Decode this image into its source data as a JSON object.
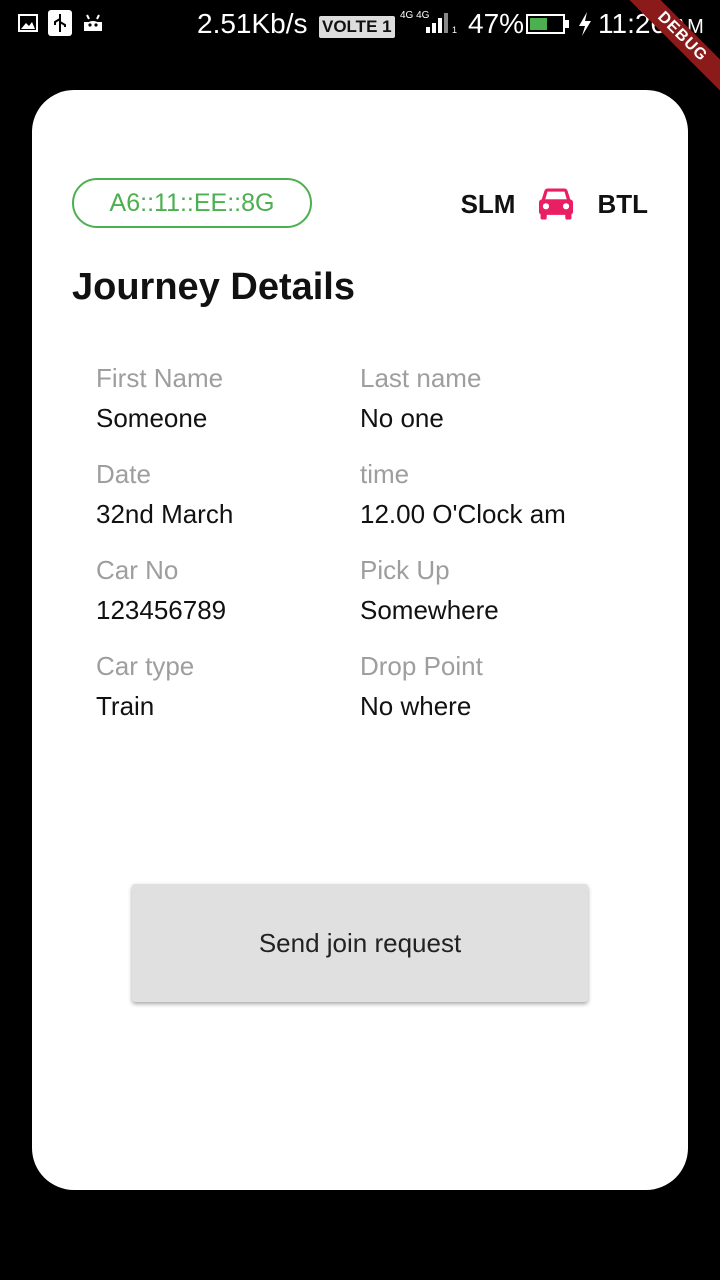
{
  "status_bar": {
    "speed": "2.51Kb/s",
    "volte": "VOLTE 1",
    "network": "4G 4G",
    "battery_percent": "47%",
    "time": "11:26",
    "ampm": "AM"
  },
  "debug_banner": "DEBUG",
  "card": {
    "device_id": "A6::11::EE::8G",
    "route": {
      "from": "SLM",
      "to": "BTL",
      "icon": "car-icon",
      "icon_color": "#e91e63"
    },
    "title": "Journey Details",
    "fields": [
      {
        "label": "First Name",
        "value": "Someone"
      },
      {
        "label": "Last name",
        "value": "No one"
      },
      {
        "label": "Date",
        "value": "32nd March"
      },
      {
        "label": "time",
        "value": "12.00 O'Clock am"
      },
      {
        "label": "Car No",
        "value": "123456789"
      },
      {
        "label": "Pick Up",
        "value": "Somewhere"
      },
      {
        "label": "Car type",
        "value": "Train"
      },
      {
        "label": "Drop Point",
        "value": "No where"
      }
    ],
    "button_label": "Send join request"
  },
  "colors": {
    "accent_green": "#4caf50",
    "car_pink": "#e91e63",
    "button_grey": "#e0e0e0"
  }
}
